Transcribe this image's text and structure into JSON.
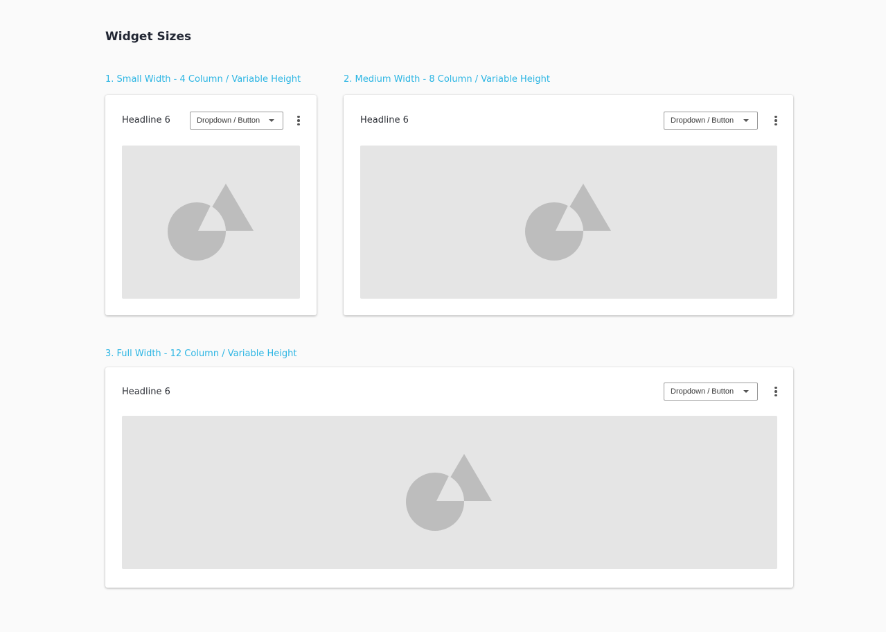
{
  "page": {
    "title": "Widget Sizes"
  },
  "sections": [
    {
      "label": "1. Small Width - 4 Column / Variable Height",
      "card": {
        "headline": "Headline 6",
        "dropdown_label": "Dropdown / Button"
      }
    },
    {
      "label": "2. Medium Width - 8 Column / Variable Height",
      "card": {
        "headline": "Headline 6",
        "dropdown_label": "Dropdown / Button"
      }
    },
    {
      "label": "3. Full Width - 12 Column / Variable Height",
      "card": {
        "headline": "Headline 6",
        "dropdown_label": "Dropdown / Button"
      }
    }
  ],
  "icons": {
    "dropdown_caret": "caret-down-icon",
    "more": "more-vertical-icon",
    "placeholder": "image-placeholder-icon"
  },
  "colors": {
    "background": "#fafafa",
    "section_label": "#2bb5e3",
    "placeholder_bg": "#e5e5e5",
    "placeholder_shape": "#bdbdbd"
  }
}
